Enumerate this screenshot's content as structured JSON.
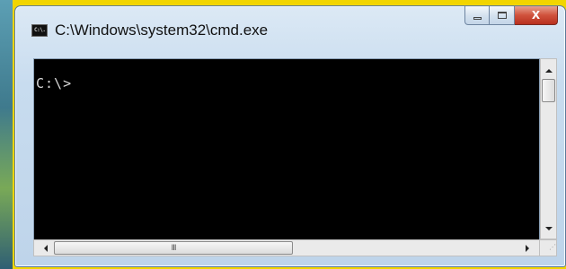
{
  "window": {
    "title": "C:\\Windows\\system32\\cmd.exe",
    "icon": "cmd-icon",
    "icon_text": "C:\\."
  },
  "caption_buttons": {
    "minimize_icon": "minimize-icon",
    "maximize_icon": "maximize-icon",
    "close_label": "X",
    "close_color": "#c9432f"
  },
  "console": {
    "prompt": "C:\\>",
    "background": "#000000",
    "foreground": "#d8d8d8"
  },
  "scrollbars": {
    "vertical": {
      "up_icon": "scroll-up-icon",
      "down_icon": "scroll-down-icon"
    },
    "horizontal": {
      "left_icon": "scroll-left-icon",
      "right_icon": "scroll-right-icon",
      "grip": "III"
    }
  }
}
